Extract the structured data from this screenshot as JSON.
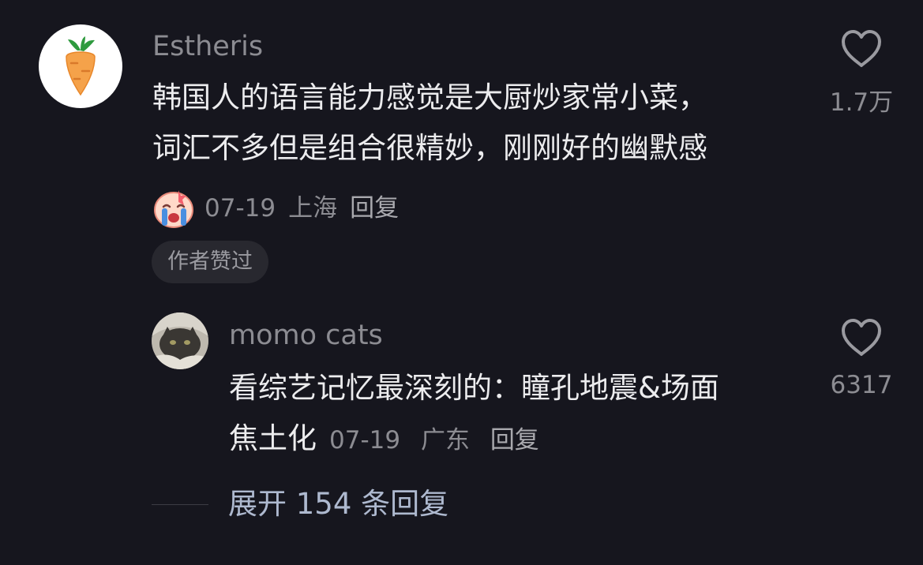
{
  "comment": {
    "username": "Estheris",
    "avatar_icon": "carrot-icon",
    "text_line1": "韩国人的语言能力感觉是大厨炒家常小菜，",
    "text_line2": "词汇不多但是组合很精妙，刚刚好的幽默感",
    "sticker_icon": "crying-emoji-sticker",
    "date": "07-19",
    "location": "上海",
    "reply_label": "回复",
    "like_count": "1.7万",
    "author_badge": "作者赞过"
  },
  "reply": {
    "username": "momo cats",
    "avatar_icon": "cat-photo-avatar",
    "text_line1": "看综艺记忆最深刻的：瞳孔地震&场面",
    "text_line2": "焦土化",
    "date": "07-19",
    "location": "广东",
    "reply_label": "回复",
    "like_count": "6317"
  },
  "expand": {
    "label": "展开 154 条回复"
  },
  "colors": {
    "background": "#16161e",
    "text_primary": "#ececee",
    "text_secondary": "#8c8c92",
    "expand_link": "#aeb9cf",
    "carrot_orange": "#f5a24a",
    "carrot_leaf": "#2e9a3e"
  }
}
